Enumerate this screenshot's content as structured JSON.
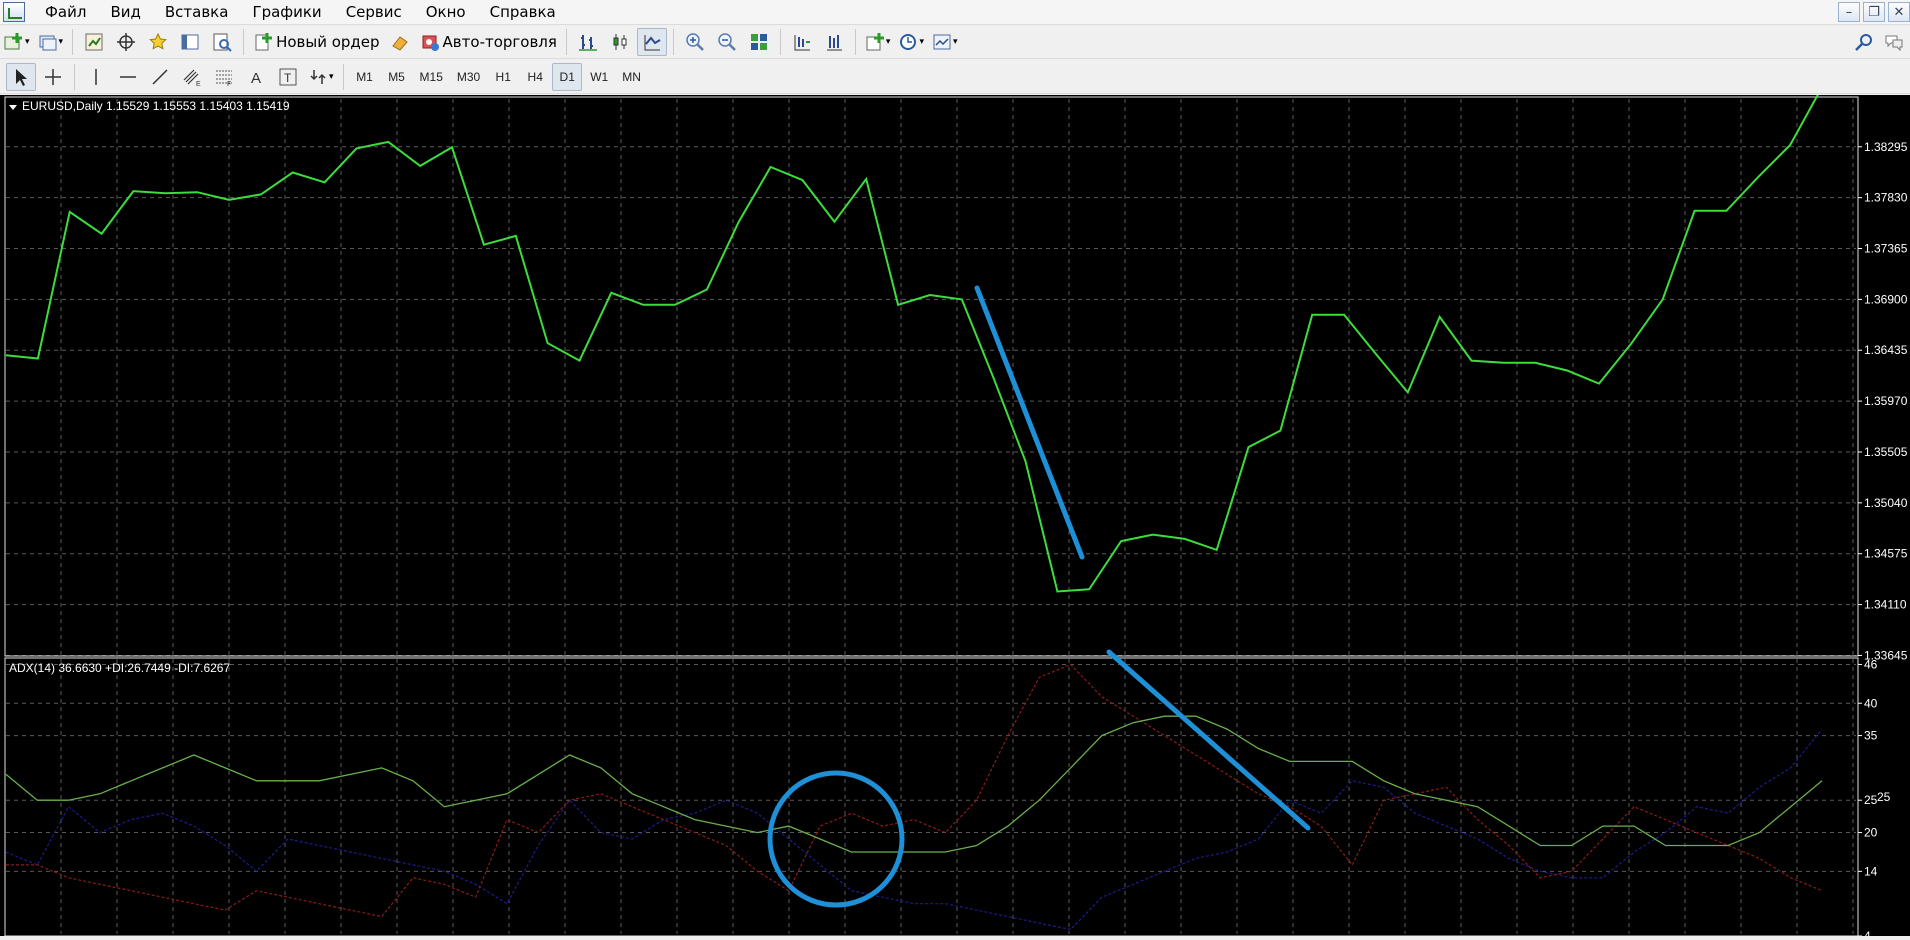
{
  "menu": {
    "items": [
      "Файл",
      "Вид",
      "Вставка",
      "Графики",
      "Сервис",
      "Окно",
      "Справка"
    ]
  },
  "toolbar": {
    "new_order_label": "Новый ордер",
    "auto_trading_label": "Авто-торговля",
    "timeframes": [
      "M1",
      "M5",
      "M15",
      "M30",
      "H1",
      "H4",
      "D1",
      "W1",
      "MN"
    ],
    "selected_timeframe": "D1"
  },
  "chart": {
    "header": "EURUSD,Daily  1.15529 1.15553 1.15403 1.15419",
    "price_axis": [
      "1.38295",
      "1.37830",
      "1.37365",
      "1.36900",
      "1.36435",
      "1.35970",
      "1.35505",
      "1.35040",
      "1.34575",
      "1.34110",
      "1.33645"
    ],
    "line_color": "#3ddc3d"
  },
  "indicator": {
    "header": "ADX(14) 36.6630 +DI:26.7449 -DI:7.6267",
    "axis": [
      "46",
      "40",
      "35",
      "25",
      "20",
      "14",
      "4"
    ],
    "axis_extra": "25"
  },
  "chart_data": [
    {
      "type": "line",
      "title": "EURUSD,Daily",
      "series": [
        {
          "name": "EURUSD",
          "values": [
            1.3639,
            1.3636,
            1.377,
            1.375,
            1.3789,
            1.3787,
            1.3788,
            1.3781,
            1.3786,
            1.3806,
            1.3797,
            1.3828,
            1.3834,
            1.3812,
            1.3829,
            1.374,
            1.3748,
            1.365,
            1.3634,
            1.3696,
            1.3685,
            1.3685,
            1.3699,
            1.3761,
            1.3811,
            1.3799,
            1.3761,
            1.38,
            1.3685,
            1.3694,
            1.369,
            1.3618,
            1.3542,
            1.3423,
            1.3425,
            1.3469,
            1.3475,
            1.3471,
            1.3461,
            1.3555,
            1.357,
            1.3676,
            1.3676,
            1.364,
            1.3605,
            1.3674,
            1.3634,
            1.3632,
            1.3632,
            1.3625,
            1.3613,
            1.3649,
            1.369,
            1.3771,
            1.3771,
            1.3802,
            1.3831,
            1.3884
          ]
        }
      ],
      "ylim": [
        1.3364,
        1.3875
      ]
    },
    {
      "type": "line",
      "title": "ADX(14)",
      "series": [
        {
          "name": "ADX",
          "values": [
            29,
            25,
            25,
            26,
            28,
            30,
            32,
            30,
            28,
            28,
            28,
            29,
            30,
            28,
            24,
            25,
            26,
            29,
            32,
            30,
            26,
            24,
            22,
            21,
            20,
            21,
            19,
            17,
            17,
            17,
            17,
            18,
            21,
            25,
            30,
            35,
            37,
            38,
            38,
            36,
            33,
            31,
            31,
            31,
            28,
            26,
            25,
            24,
            21,
            18,
            18,
            21,
            21,
            18,
            18,
            18,
            20,
            24,
            28
          ]
        },
        {
          "name": "+DI",
          "values": [
            15,
            15,
            13,
            12,
            11,
            10,
            9,
            8,
            11,
            10,
            9,
            8,
            7,
            13,
            12,
            10,
            22,
            20,
            25,
            26,
            24,
            22,
            20,
            18,
            14,
            11,
            21,
            23,
            21,
            22,
            20,
            25,
            35,
            44,
            46,
            41,
            38,
            35,
            32,
            29,
            26,
            24,
            21,
            15,
            25,
            26,
            27,
            22,
            18,
            13,
            14,
            19,
            24,
            22,
            20,
            18,
            16,
            13,
            11
          ]
        },
        {
          "name": "-DI",
          "values": [
            17,
            15,
            24,
            20,
            22,
            23,
            21,
            18,
            14,
            19,
            18,
            17,
            16,
            15,
            14,
            12,
            9,
            18,
            25,
            20,
            19,
            22,
            23,
            25,
            23,
            19,
            15,
            11,
            10,
            9,
            9,
            8,
            7,
            6,
            5,
            10,
            12,
            14,
            16,
            17,
            19,
            25,
            23,
            28,
            27,
            23,
            21,
            19,
            16,
            14,
            13,
            13,
            17,
            20,
            24,
            23,
            27,
            30,
            36
          ]
        }
      ],
      "ylim": [
        4,
        47
      ]
    }
  ]
}
